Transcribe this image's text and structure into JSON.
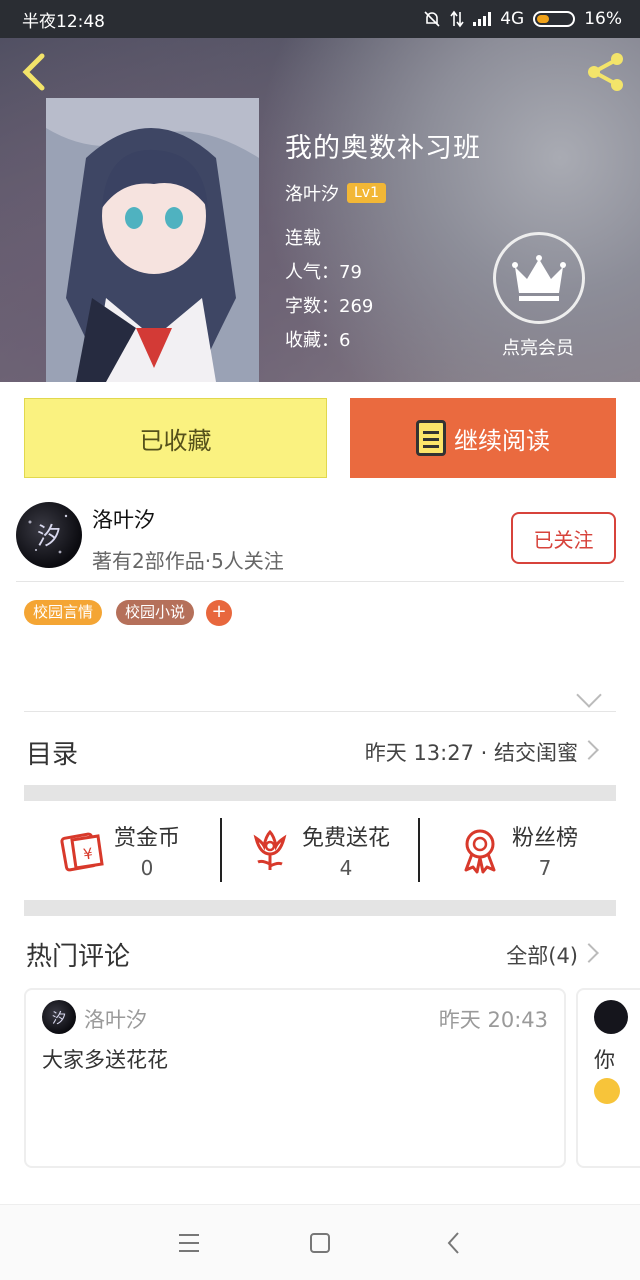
{
  "status_bar": {
    "time": "半夜12:48",
    "network": "4G",
    "battery": "16%"
  },
  "book": {
    "title": "我的奥数补习班",
    "author": "洛叶汐",
    "level": "Lv1",
    "status": "连载",
    "popularity": "人气：79",
    "word_count": "字数：269",
    "favorites": "收藏：6",
    "vip_label": "点亮会员"
  },
  "actions": {
    "collect_label": "已收藏",
    "read_label": "继续阅读"
  },
  "author": {
    "name": "洛叶汐",
    "summary": "著有2部作品·5人关注",
    "follow_label": "已关注",
    "avatar_text": "汐"
  },
  "tags": [
    {
      "label": "校园言情",
      "color": "#f4a534"
    },
    {
      "label": "校园小说",
      "color": "#b5705a"
    }
  ],
  "tag_add": "+",
  "catalog": {
    "title": "目录",
    "latest": "昨天 13:27 · 结交闺蜜"
  },
  "stats": [
    {
      "label": "赏金币",
      "value": "0",
      "icon": "red-envelope-icon"
    },
    {
      "label": "免费送花",
      "value": "4",
      "icon": "flower-icon"
    },
    {
      "label": "粉丝榜",
      "value": "7",
      "icon": "award-ribbon-icon"
    }
  ],
  "comments_section": {
    "title": "热门评论",
    "all_label": "全部(4)"
  },
  "comments": [
    {
      "user": "洛叶汐",
      "time": "昨天 20:43",
      "text": "大家多送花花",
      "avatar_text": "汐"
    },
    {
      "partial_text": "你"
    }
  ],
  "colors": {
    "accent_orange": "#ea6a3f",
    "collect_yellow": "#faf280",
    "follow_red": "#d7433b",
    "icon_red": "#d8392b"
  }
}
